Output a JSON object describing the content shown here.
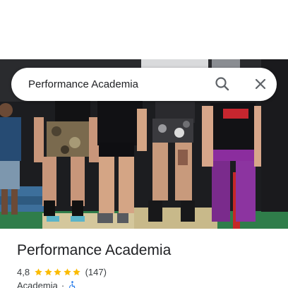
{
  "search": {
    "query": "Performance Academia",
    "search_icon": "search-icon",
    "close_icon": "close-icon"
  },
  "hero": {
    "image": "gym-group-photo"
  },
  "place": {
    "name": "Performance Academia",
    "rating": "4,8",
    "stars": 5,
    "review_count": "(147)",
    "category": "Academia",
    "separator": "·",
    "accessibility_icon": "wheelchair-icon"
  },
  "colors": {
    "star": "#fbbc04",
    "accessibility": "#1a73e8",
    "text_primary": "#202124",
    "text_secondary": "#3c4043"
  }
}
